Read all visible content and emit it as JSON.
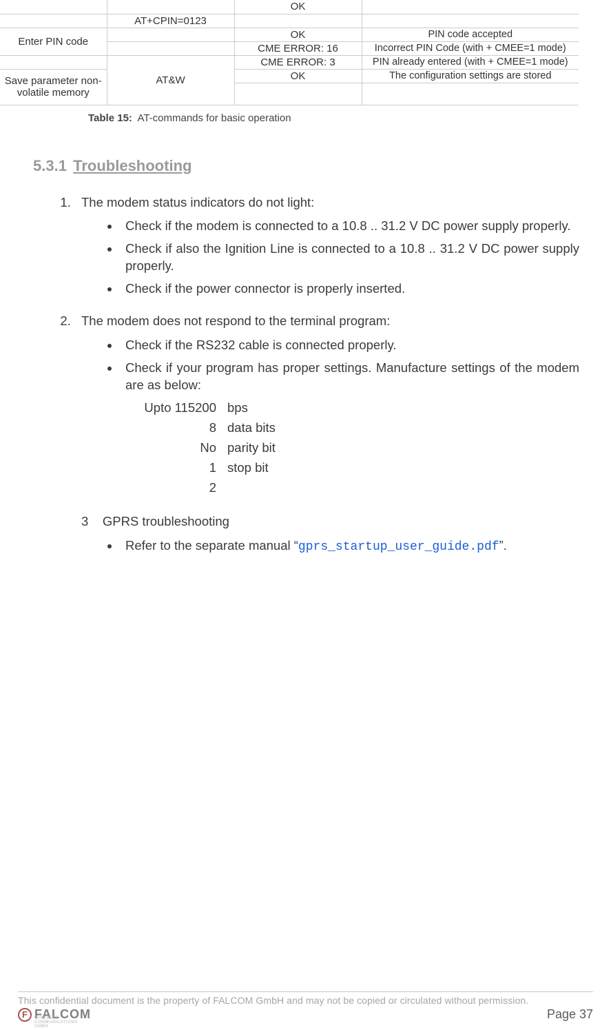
{
  "table": {
    "rows": [
      {
        "c0": "",
        "c1": "",
        "c2": "OK",
        "c3": ""
      },
      {
        "c0": "",
        "c1": "AT+CPIN=0123",
        "c2": "",
        "c3": ""
      },
      {
        "c0": "Enter PIN code",
        "c0_rowspan": 2,
        "c1": "",
        "c2": "OK",
        "c3": "PIN code accepted"
      },
      {
        "c1": "",
        "c2": "CME ERROR: 16",
        "c3": "Incorrect PIN Code (with + CMEE=1 mode)"
      },
      {
        "c0": "",
        "c1": "AT&W",
        "c1_rowspan": 3,
        "c2": "CME ERROR: 3",
        "c3": "PIN already entered (with + CMEE=1 mode)"
      },
      {
        "c0": "Save parameter non-volatile memory",
        "c0_rowspan": 2,
        "c2": "OK",
        "c3": "The configuration settings are stored"
      },
      {
        "c2": "",
        "c3": ""
      }
    ]
  },
  "caption": {
    "label": "Table 15:",
    "text": "AT-commands for basic operation"
  },
  "heading": {
    "num": "5.3.1",
    "title": "Troubleshooting"
  },
  "list": {
    "item1": {
      "lead": "The modem status indicators do not light:",
      "bullets": [
        "Check if the modem is connected to a 10.8 .. 31.2 V DC power supply properly.",
        "Check if also the Ignition Line is connected to a 10.8 .. 31.2 V DC power supply properly.",
        "Check if the power connector is properly inserted."
      ]
    },
    "item2": {
      "lead": "The modem does not respond to the terminal program:",
      "bullets": [
        "Check if the RS232 cable is connected properly.",
        "Check if your program has proper settings. Manufacture settings of the modem are as below:"
      ],
      "settings": [
        {
          "v": "Upto 115200",
          "l": "bps"
        },
        {
          "v": "8",
          "l": "data bits"
        },
        {
          "v": "No",
          "l": "parity bit"
        },
        {
          "v": "1",
          "l": "stop bit"
        },
        {
          "v": "2",
          "l": ""
        }
      ]
    },
    "item3": {
      "num": "3",
      "lead": "GPRS troubleshooting",
      "bullet_pre": "Refer to the separate manual “",
      "bullet_code": "gprs_startup_user_guide.pdf",
      "bullet_post": "”."
    }
  },
  "footer": {
    "note": "This confidential document is the property of FALCOM GmbH and may not be copied or circulated without permission.",
    "page": "Page 37",
    "logo_word": "FALCOM",
    "logo_tag": "WIRELESS COMMUNICATIONS GMBH"
  }
}
